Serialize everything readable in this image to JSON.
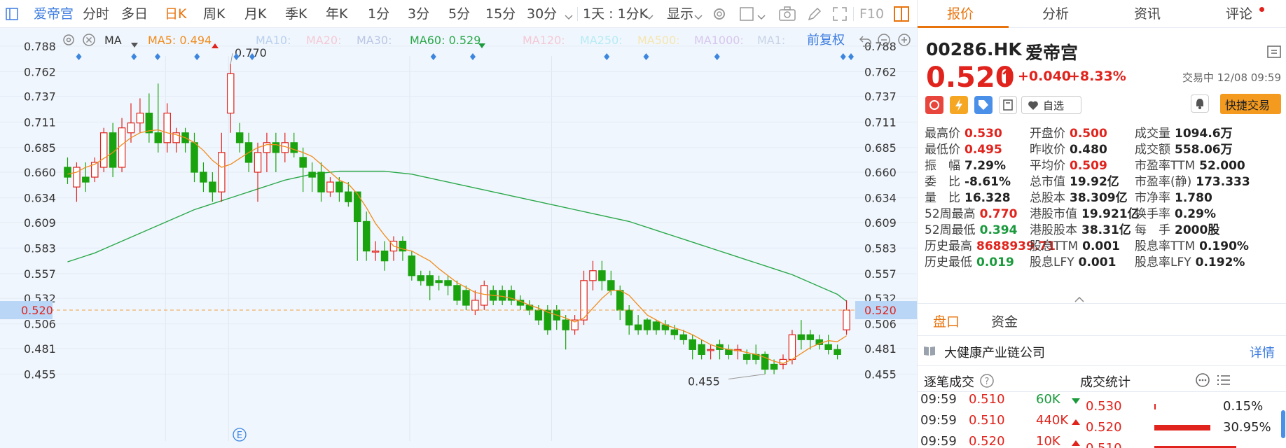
{
  "toolbar": {
    "stock_name": "爱帝宫",
    "periods": [
      "分时",
      "多日",
      "日K",
      "周K",
      "月K",
      "季K",
      "年K",
      "1分",
      "3分",
      "5分",
      "15分",
      "30分"
    ],
    "active_period": "日K",
    "combo_label": "1天 : 1分K",
    "display_label": "显示",
    "f10_label": "F10"
  },
  "ma_bar": {
    "ma_label": "MA",
    "ma5": "MA5: 0.494",
    "ma10": "MA10:",
    "ma20": "MA20:",
    "ma30": "MA30:",
    "ma60": "MA60: 0.529",
    "ma120": "MA120:",
    "ma250": "MA250:",
    "ma500": "MA500:",
    "ma1000": "MA1000:",
    "ma1": "MA1:",
    "adjust_label": "前复权",
    "colors": {
      "ma5": "#f08c1c",
      "ma60": "#2aa84a",
      "ma_dim": "#b9c7e6"
    }
  },
  "chart_data": {
    "type": "candlestick",
    "y_ticks": [
      "0.788",
      "0.762",
      "0.737",
      "0.711",
      "0.685",
      "0.660",
      "0.634",
      "0.609",
      "0.583",
      "0.557",
      "0.532",
      "0.506",
      "0.481",
      "0.455"
    ],
    "ylim": [
      0.444,
      0.8
    ],
    "current_price": "0.520",
    "high_annotation": "0.770",
    "low_annotation": "0.455",
    "event_marker": "E",
    "candles": [
      [
        0.665,
        0.655,
        0.675,
        0.648
      ],
      [
        0.645,
        0.665,
        0.67,
        0.63
      ],
      [
        0.655,
        0.65,
        0.67,
        0.64
      ],
      [
        0.655,
        0.67,
        0.675,
        0.65
      ],
      [
        0.665,
        0.7,
        0.705,
        0.66
      ],
      [
        0.7,
        0.665,
        0.71,
        0.655
      ],
      [
        0.665,
        0.705,
        0.715,
        0.66
      ],
      [
        0.7,
        0.71,
        0.73,
        0.69
      ],
      [
        0.71,
        0.72,
        0.735,
        0.7
      ],
      [
        0.72,
        0.7,
        0.74,
        0.69
      ],
      [
        0.7,
        0.69,
        0.75,
        0.68
      ],
      [
        0.69,
        0.72,
        0.73,
        0.68
      ],
      [
        0.69,
        0.7,
        0.705,
        0.68
      ],
      [
        0.7,
        0.69,
        0.705,
        0.68
      ],
      [
        0.69,
        0.66,
        0.7,
        0.65
      ],
      [
        0.66,
        0.65,
        0.67,
        0.64
      ],
      [
        0.65,
        0.64,
        0.66,
        0.63
      ],
      [
        0.64,
        0.68,
        0.7,
        0.63
      ],
      [
        0.72,
        0.76,
        0.77,
        0.7
      ],
      [
        0.7,
        0.69,
        0.71,
        0.68
      ],
      [
        0.69,
        0.67,
        0.7,
        0.66
      ],
      [
        0.66,
        0.68,
        0.69,
        0.63
      ],
      [
        0.68,
        0.69,
        0.7,
        0.66
      ],
      [
        0.69,
        0.68,
        0.7,
        0.66
      ],
      [
        0.68,
        0.69,
        0.7,
        0.67
      ],
      [
        0.69,
        0.68,
        0.7,
        0.675
      ],
      [
        0.675,
        0.665,
        0.685,
        0.64
      ],
      [
        0.66,
        0.655,
        0.67,
        0.64
      ],
      [
        0.66,
        0.64,
        0.67,
        0.63
      ],
      [
        0.64,
        0.65,
        0.655,
        0.635
      ],
      [
        0.65,
        0.64,
        0.655,
        0.63
      ],
      [
        0.64,
        0.63,
        0.65,
        0.625
      ],
      [
        0.64,
        0.61,
        0.64,
        0.57
      ],
      [
        0.61,
        0.58,
        0.62,
        0.57
      ],
      [
        0.58,
        0.58,
        0.59,
        0.57
      ],
      [
        0.58,
        0.57,
        0.59,
        0.56
      ],
      [
        0.58,
        0.59,
        0.595,
        0.57
      ],
      [
        0.59,
        0.58,
        0.595,
        0.57
      ],
      [
        0.575,
        0.555,
        0.58,
        0.55
      ],
      [
        0.555,
        0.55,
        0.56,
        0.545
      ],
      [
        0.555,
        0.545,
        0.56,
        0.53
      ],
      [
        0.55,
        0.548,
        0.555,
        0.54
      ],
      [
        0.55,
        0.545,
        0.555,
        0.535
      ],
      [
        0.545,
        0.53,
        0.55,
        0.525
      ],
      [
        0.54,
        0.525,
        0.545,
        0.52
      ],
      [
        0.52,
        0.53,
        0.54,
        0.515
      ],
      [
        0.525,
        0.545,
        0.55,
        0.52
      ],
      [
        0.54,
        0.53,
        0.545,
        0.525
      ],
      [
        0.54,
        0.53,
        0.545,
        0.525
      ],
      [
        0.54,
        0.53,
        0.545,
        0.525
      ],
      [
        0.53,
        0.525,
        0.535,
        0.52
      ],
      [
        0.525,
        0.52,
        0.53,
        0.515
      ],
      [
        0.52,
        0.51,
        0.525,
        0.505
      ],
      [
        0.52,
        0.5,
        0.525,
        0.495
      ],
      [
        0.52,
        0.51,
        0.525,
        0.5
      ],
      [
        0.51,
        0.5,
        0.515,
        0.48
      ],
      [
        0.5,
        0.51,
        0.515,
        0.495
      ],
      [
        0.51,
        0.55,
        0.56,
        0.505
      ],
      [
        0.55,
        0.56,
        0.57,
        0.54
      ],
      [
        0.56,
        0.55,
        0.57,
        0.54
      ],
      [
        0.55,
        0.54,
        0.56,
        0.535
      ],
      [
        0.54,
        0.52,
        0.545,
        0.51
      ],
      [
        0.52,
        0.505,
        0.525,
        0.495
      ],
      [
        0.505,
        0.5,
        0.515,
        0.495
      ],
      [
        0.51,
        0.5,
        0.512,
        0.495
      ],
      [
        0.508,
        0.5,
        0.51,
        0.495
      ],
      [
        0.505,
        0.5,
        0.51,
        0.495
      ],
      [
        0.5,
        0.495,
        0.505,
        0.49
      ],
      [
        0.495,
        0.49,
        0.5,
        0.485
      ],
      [
        0.49,
        0.48,
        0.495,
        0.47
      ],
      [
        0.485,
        0.475,
        0.49,
        0.47
      ],
      [
        0.48,
        0.48,
        0.485,
        0.47
      ],
      [
        0.485,
        0.48,
        0.49,
        0.47
      ],
      [
        0.48,
        0.475,
        0.485,
        0.47
      ],
      [
        0.48,
        0.48,
        0.485,
        0.47
      ],
      [
        0.475,
        0.47,
        0.48,
        0.465
      ],
      [
        0.475,
        0.47,
        0.485,
        0.465
      ],
      [
        0.475,
        0.46,
        0.478,
        0.455
      ],
      [
        0.465,
        0.46,
        0.47,
        0.455
      ],
      [
        0.465,
        0.47,
        0.475,
        0.46
      ],
      [
        0.47,
        0.495,
        0.5,
        0.465
      ],
      [
        0.495,
        0.49,
        0.51,
        0.48
      ],
      [
        0.495,
        0.49,
        0.5,
        0.48
      ],
      [
        0.49,
        0.485,
        0.495,
        0.48
      ],
      [
        0.485,
        0.48,
        0.495,
        0.475
      ],
      [
        0.48,
        0.475,
        0.485,
        0.47
      ],
      [
        0.5,
        0.52,
        0.53,
        0.495
      ]
    ],
    "ma5": [
      0.658,
      0.66,
      0.665,
      0.668,
      0.674,
      0.68,
      0.688,
      0.695,
      0.7,
      0.702,
      0.703,
      0.7,
      0.698,
      0.695,
      0.69,
      0.682,
      0.672,
      0.665,
      0.668,
      0.674,
      0.68,
      0.685,
      0.688,
      0.688,
      0.686,
      0.683,
      0.68,
      0.676,
      0.668,
      0.66,
      0.652,
      0.648,
      0.638,
      0.624,
      0.608,
      0.596,
      0.585,
      0.582,
      0.58,
      0.575,
      0.57,
      0.562,
      0.555,
      0.548,
      0.543,
      0.538,
      0.536,
      0.535,
      0.534,
      0.532,
      0.529,
      0.525,
      0.522,
      0.518,
      0.515,
      0.512,
      0.508,
      0.512,
      0.522,
      0.532,
      0.54,
      0.54,
      0.535,
      0.525,
      0.515,
      0.51,
      0.505,
      0.502,
      0.499,
      0.495,
      0.49,
      0.485,
      0.482,
      0.48,
      0.479,
      0.477,
      0.475,
      0.472,
      0.468,
      0.466,
      0.47,
      0.476,
      0.482,
      0.486,
      0.489,
      0.488,
      0.494
    ],
    "ma60": [
      0.569,
      0.572,
      0.575,
      0.578,
      0.582,
      0.586,
      0.59,
      0.594,
      0.598,
      0.602,
      0.606,
      0.61,
      0.614,
      0.618,
      0.622,
      0.625,
      0.628,
      0.631,
      0.634,
      0.637,
      0.64,
      0.643,
      0.646,
      0.649,
      0.652,
      0.654,
      0.656,
      0.658,
      0.659,
      0.66,
      0.661,
      0.661,
      0.661,
      0.661,
      0.661,
      0.661,
      0.66,
      0.659,
      0.658,
      0.656,
      0.654,
      0.652,
      0.65,
      0.648,
      0.646,
      0.644,
      0.642,
      0.64,
      0.638,
      0.636,
      0.634,
      0.632,
      0.63,
      0.628,
      0.626,
      0.624,
      0.622,
      0.62,
      0.618,
      0.616,
      0.614,
      0.612,
      0.61,
      0.607,
      0.604,
      0.601,
      0.598,
      0.595,
      0.592,
      0.589,
      0.586,
      0.583,
      0.58,
      0.577,
      0.574,
      0.571,
      0.568,
      0.565,
      0.562,
      0.559,
      0.556,
      0.552,
      0.548,
      0.544,
      0.54,
      0.536,
      0.529
    ],
    "dots": [
      0.02,
      0.09,
      0.12,
      0.17,
      0.22,
      0.24,
      0.47,
      0.52,
      0.69,
      0.74,
      0.83,
      0.99,
      1.0
    ]
  },
  "quote": {
    "code": "00286.HK",
    "name": "爱帝宫",
    "price": "0.520",
    "arrow": "↑",
    "change": "+0.040",
    "change_pct": "+8.33%",
    "status": "交易中 12/08 09:59",
    "watch_label": "自选",
    "quick_trade": "快捷交易"
  },
  "tabs": [
    "报价",
    "分析",
    "资讯",
    "评论"
  ],
  "stats": [
    [
      {
        "l": "最高价",
        "v": "0.530",
        "c": "red"
      },
      {
        "l": "开盘价",
        "v": "0.500",
        "c": "red"
      },
      {
        "l": "成交量",
        "v": "1094.6万",
        "c": ""
      }
    ],
    [
      {
        "l": "最低价",
        "v": "0.495",
        "c": "red"
      },
      {
        "l": "昨收价",
        "v": "0.480",
        "c": ""
      },
      {
        "l": "成交额",
        "v": "558.06万",
        "c": ""
      }
    ],
    [
      {
        "l": "振　幅",
        "v": "7.29%",
        "c": ""
      },
      {
        "l": "平均价",
        "v": "0.509",
        "c": "red"
      },
      {
        "l": "市盈率TTM",
        "v": "52.000",
        "c": ""
      }
    ],
    [
      {
        "l": "委　比",
        "v": "-8.61%",
        "c": ""
      },
      {
        "l": "总市值",
        "v": "19.92亿",
        "c": ""
      },
      {
        "l": "市盈率(静)",
        "v": "173.333",
        "c": ""
      }
    ],
    [
      {
        "l": "量　比",
        "v": "16.328",
        "c": ""
      },
      {
        "l": "总股本",
        "v": "38.309亿",
        "c": ""
      },
      {
        "l": "市净率",
        "v": "1.780",
        "c": ""
      }
    ],
    [
      {
        "l": "52周最高",
        "v": "0.770",
        "c": "red"
      },
      {
        "l": "港股市值",
        "v": "19.921亿",
        "c": ""
      },
      {
        "l": "换手率",
        "v": "0.29%",
        "c": ""
      }
    ],
    [
      {
        "l": "52周最低",
        "v": "0.394",
        "c": "green"
      },
      {
        "l": "港股股本",
        "v": "38.31亿",
        "c": ""
      },
      {
        "l": "每　手",
        "v": "2000股",
        "c": ""
      }
    ],
    [
      {
        "l": "历史最高",
        "v": "8688939.71",
        "c": "red"
      },
      {
        "l": "股息TTM",
        "v": "0.001",
        "c": ""
      },
      {
        "l": "股息率TTM",
        "v": "0.190%",
        "c": ""
      }
    ],
    [
      {
        "l": "历史最低",
        "v": "0.019",
        "c": "green"
      },
      {
        "l": "股息LFY",
        "v": "0.001",
        "c": ""
      },
      {
        "l": "股息率LFY",
        "v": "0.192%",
        "c": ""
      }
    ]
  ],
  "sub_tabs": [
    "盘口",
    "资金"
  ],
  "industry": {
    "name": "大健康产业链公司",
    "detail": "详情"
  },
  "ticks": {
    "title": "逐笔成交",
    "rows": [
      {
        "t": "09:59",
        "p": "0.510",
        "v": "60K",
        "dir": "down"
      },
      {
        "t": "09:59",
        "p": "0.510",
        "v": "440K",
        "dir": "up"
      },
      {
        "t": "09:59",
        "p": "0.520",
        "v": "10K",
        "dir": "up"
      }
    ]
  },
  "stats_table": {
    "title": "成交统计",
    "rows": [
      {
        "p": "0.530",
        "pct": "0.15%",
        "frac": 0.0015
      },
      {
        "p": "0.520",
        "pct": "30.95%",
        "frac": 0.3095
      },
      {
        "p": "0.510",
        "pct": "",
        "frac": 0.45
      }
    ]
  }
}
